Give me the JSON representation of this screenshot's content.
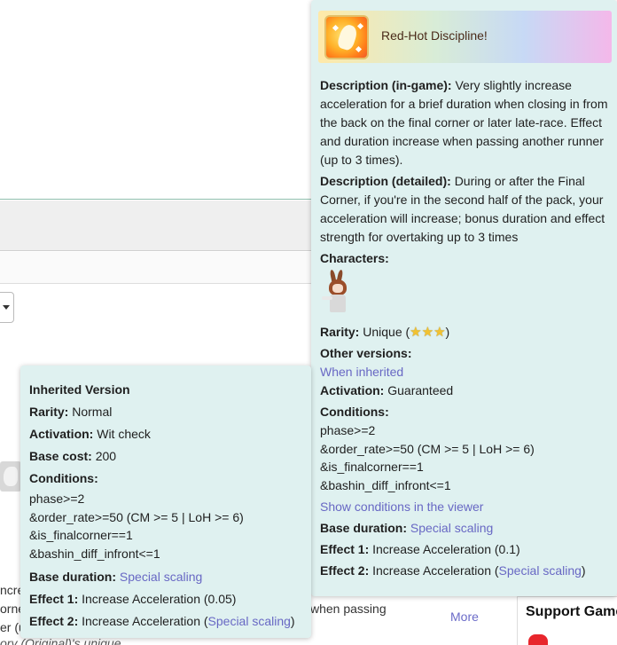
{
  "background": {
    "line1_fragment": "ncre",
    "line2_fragment": "orne",
    "line3_fragment": "er (u",
    "line4_fragment": "ory (Original)'s unique",
    "passing_text": "when passing",
    "more_label": "More",
    "sidebar_title": "Support Game"
  },
  "skill_tooltip": {
    "name": "Red-Hot Discipline!",
    "icon": "running-figure-skill-icon",
    "description_ingame_label": "Description (in-game):",
    "description_ingame": "Very slightly increase acceleration for a brief duration when closing in from the back on the final corner or later late-race. Effect and duration increase when passing another runner (up to 3 times).",
    "description_detailed_label": "Description (detailed):",
    "description_detailed": "During or after the Final Corner, if you're in the second half of the pack, your acceleration will increase; bonus duration and effect strength for overtaking up to 3 times",
    "characters_label": "Characters:",
    "rarity_label": "Rarity:",
    "rarity_value": "Unique (",
    "rarity_stars": "★★★",
    "rarity_close": ")",
    "other_versions_label": "Other versions:",
    "other_versions_link": "When inherited",
    "activation_label": "Activation:",
    "activation_value": "Guaranteed",
    "conditions_label": "Conditions:",
    "conditions": [
      "phase>=2",
      "&order_rate>=50 (CM >= 5 | LoH >= 6)",
      "&is_finalcorner==1",
      "&bashin_diff_infront<=1"
    ],
    "show_conditions_link": "Show conditions in the viewer",
    "base_duration_label": "Base duration:",
    "base_duration_link": "Special scaling",
    "effect1_label": "Effect 1:",
    "effect1_value": "Increase Acceleration (0.1)",
    "effect2_label": "Effect 2:",
    "effect2_prefix": "Increase Acceleration (",
    "effect2_link": "Special scaling",
    "effect2_suffix": ")"
  },
  "inherited_tooltip": {
    "title": "Inherited Version",
    "rarity_label": "Rarity:",
    "rarity_value": "Normal",
    "activation_label": "Activation:",
    "activation_value": "Wit check",
    "base_cost_label": "Base cost:",
    "base_cost_value": "200",
    "conditions_label": "Conditions:",
    "conditions": [
      "phase>=2",
      "&order_rate>=50 (CM >= 5 | LoH >= 6)",
      "&is_finalcorner==1",
      "&bashin_diff_infront<=1"
    ],
    "base_duration_label": "Base duration:",
    "base_duration_link": "Special scaling",
    "effect1_label": "Effect 1:",
    "effect1_value": "Increase Acceleration (0.05)",
    "effect2_label": "Effect 2:",
    "effect2_prefix": "Increase Acceleration (",
    "effect2_link": "Special scaling",
    "effect2_suffix": ")"
  },
  "colors": {
    "card_background": "#dff1f0",
    "link": "#6868c4",
    "star": "#f2c230"
  }
}
